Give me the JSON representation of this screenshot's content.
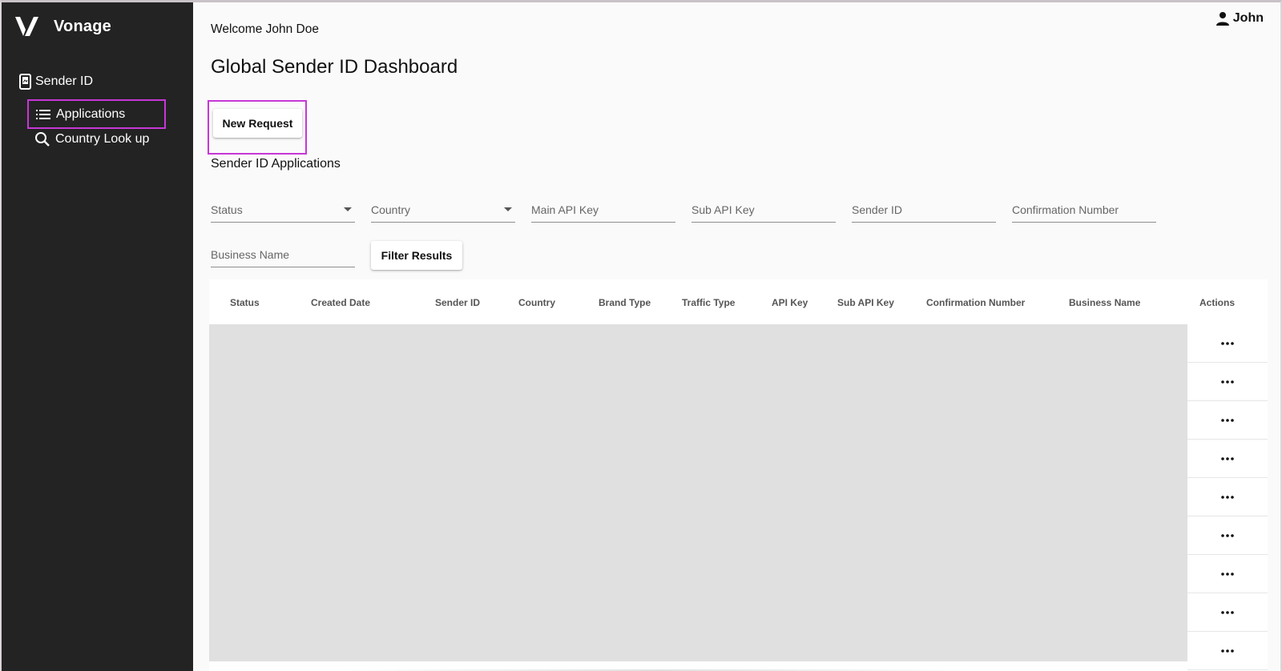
{
  "sidebar": {
    "brand": "Vonage",
    "section_label": "Sender ID",
    "items": [
      {
        "label": "Applications",
        "icon": "list-icon",
        "active": true
      },
      {
        "label": "Country Look up",
        "icon": "search-icon",
        "active": false
      }
    ]
  },
  "header": {
    "user": "John",
    "welcome_prefix": "Welcome",
    "welcome_name": "John Doe",
    "title": "Global Sender ID Dashboard"
  },
  "actions": {
    "new_request": "New Request",
    "filter_results": "Filter Results"
  },
  "filters": {
    "section_title": "Sender ID Applications",
    "status": "Status",
    "country": "Country",
    "main_api_key": "Main API Key",
    "sub_api_key": "Sub API Key",
    "sender_id": "Sender ID",
    "confirmation_number": "Confirmation Number",
    "business_name": "Business Name"
  },
  "table": {
    "columns": [
      "Status",
      "Created Date",
      "Sender ID",
      "Country",
      "Brand Type",
      "Traffic Type",
      "API Key",
      "Sub API Key",
      "Confirmation Number",
      "Business Name",
      "Actions"
    ],
    "row_count": 9,
    "row_action_icon": "more-horiz-icon"
  },
  "colors": {
    "sidebar_bg": "#232323",
    "highlight": "#c637d6",
    "content_bg": "#fafafa",
    "placeholder": "#e0e0e0"
  }
}
